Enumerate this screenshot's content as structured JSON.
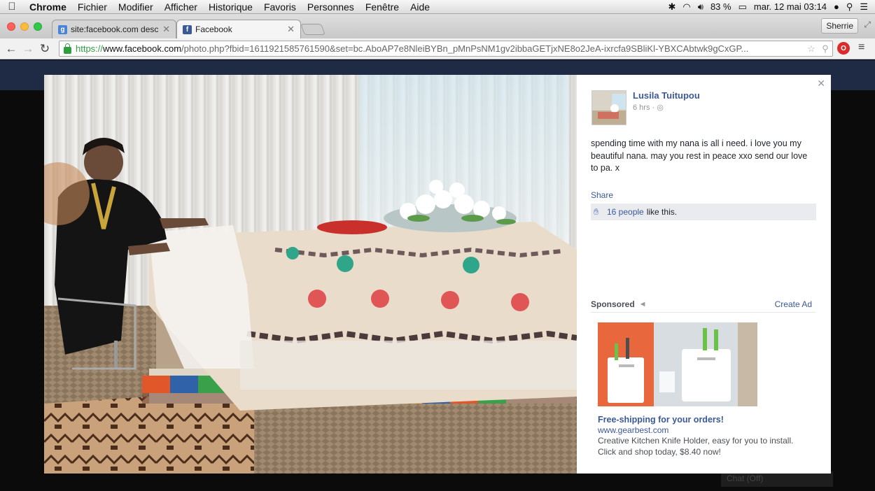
{
  "menubar": {
    "apple": "",
    "items": [
      "Chrome",
      "Fichier",
      "Modifier",
      "Afficher",
      "Historique",
      "Favoris",
      "Personnes",
      "Fenêtre",
      "Aide"
    ],
    "battery": "83 %",
    "clock": "mar. 12 mai  03:14"
  },
  "tabs": [
    {
      "title": "site:facebook.com descanso",
      "favicon": "google-icon"
    },
    {
      "title": "Facebook",
      "favicon": "facebook-icon"
    }
  ],
  "profile_button": "Sherrie",
  "address": {
    "scheme": "https://",
    "host": "www.facebook.com",
    "path": "/photo.php?fbid=1611921585761590&set=bc.AboAP7e8NleiBYBn_pMnPsNM1gv2ibbaGETjxNE8o2JeA-ixrcfa9SBliKl-YBXCAbtwk9gCxGP..."
  },
  "post": {
    "author": "Lusila Tuitupou",
    "time": "6 hrs ·",
    "text": "spending time with my nana is all i need. i love you my beautiful nana. may you rest in peace xxo send our love to pa. x",
    "share_label": "Share",
    "likes_count": "16 people",
    "likes_suffix": "like this."
  },
  "sponsored": {
    "label": "Sponsored",
    "create_ad": "Create Ad",
    "ad_title": "Free-shipping for your orders!",
    "ad_url": "www.gearbest.com",
    "ad_description": "Creative Kitchen Knife Holder, easy for you to install. Click and shop today, $8.40 now!"
  },
  "chat": "Chat (Off)",
  "colors": {
    "facebook_blue": "#3b5998",
    "fb_bar": "#1f2a44"
  }
}
